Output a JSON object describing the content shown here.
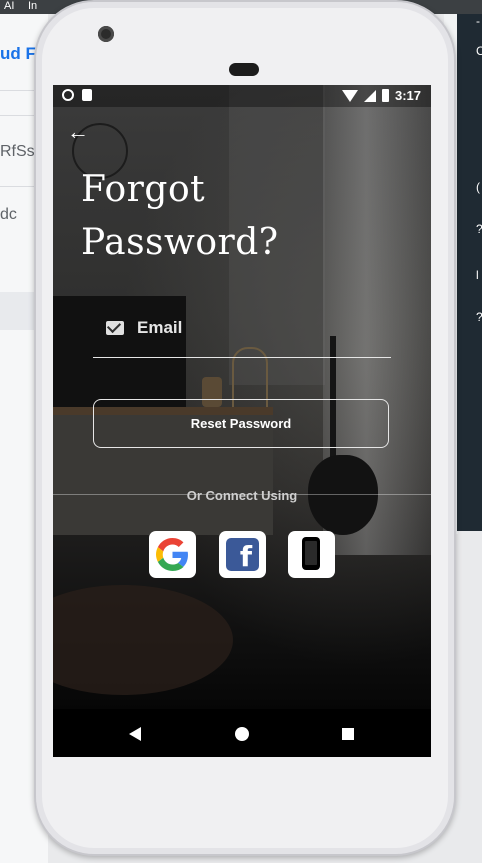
{
  "background": {
    "tab_labels": [
      "AI",
      "In"
    ],
    "title_fragment": "ud Fi",
    "fragments": [
      "RfSs",
      "dc"
    ],
    "right_glyphs": [
      "-",
      "C",
      "(",
      "?",
      "l",
      "?"
    ]
  },
  "statusbar": {
    "time": "3:17"
  },
  "screen": {
    "title_line1": "Forgot",
    "title_line2": "Password?",
    "email": {
      "value": "",
      "placeholder": "Email"
    },
    "reset_button": "Reset Password",
    "divider_label": "Or Connect Using",
    "social": {
      "google_icon": "google-icon",
      "facebook_icon": "facebook-icon",
      "phone_icon": "mobile-phone-icon",
      "facebook_glyph": "f"
    }
  },
  "colors": {
    "accent": "#ffffff",
    "google_blue": "#4285F4",
    "google_red": "#EA4335",
    "google_yellow": "#FBBC05",
    "google_green": "#34A853",
    "facebook": "#3b5998"
  }
}
